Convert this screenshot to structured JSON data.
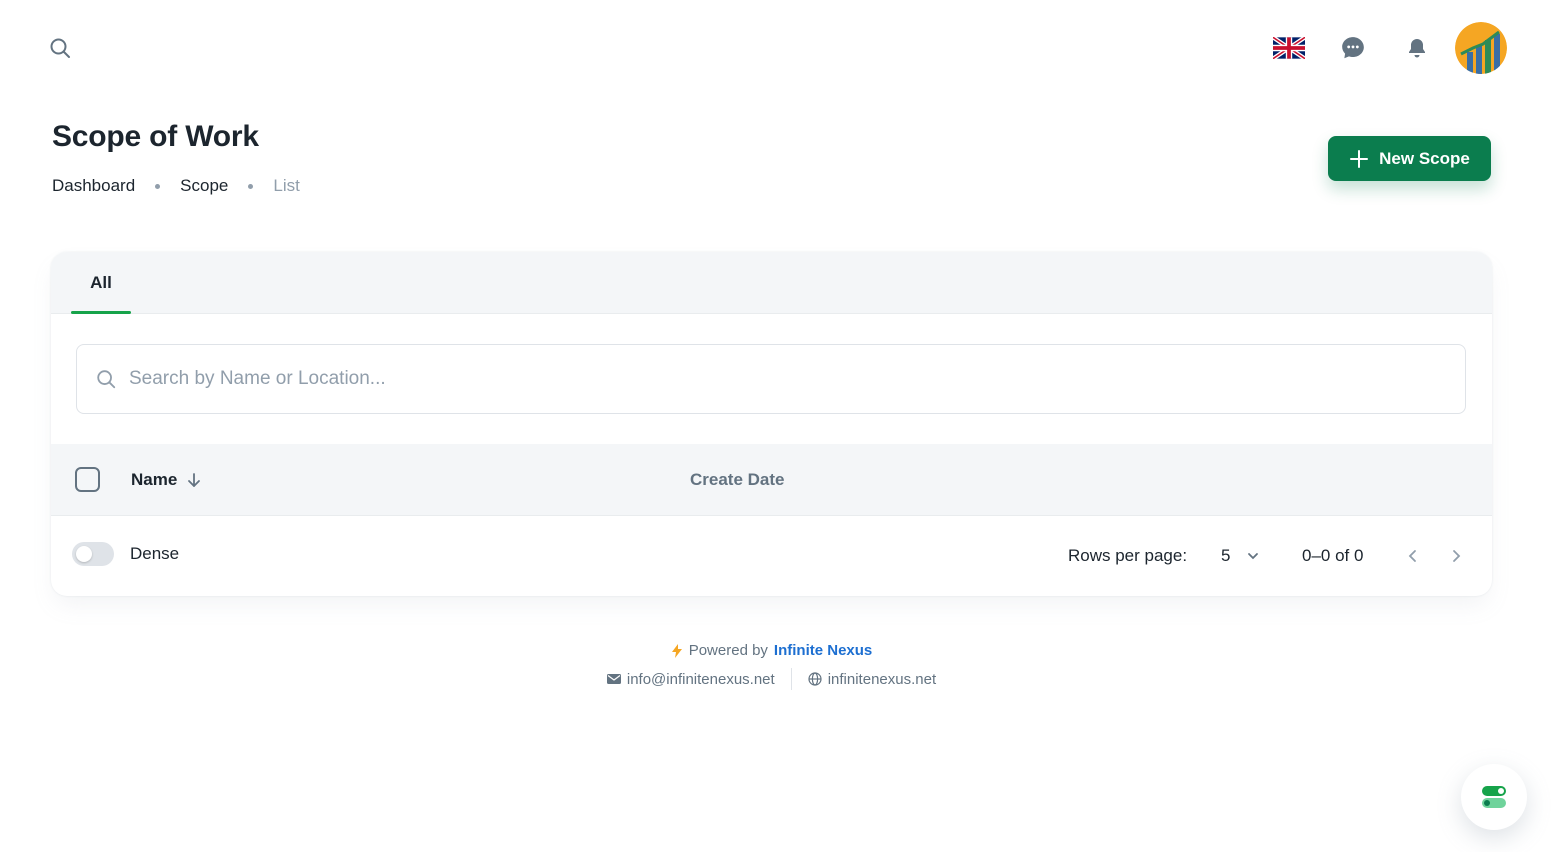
{
  "header": {
    "search_icon": "search-icon",
    "language_icon": "uk-flag-icon",
    "chat_icon": "chat-icon",
    "notification_icon": "bell-icon"
  },
  "page": {
    "title": "Scope of Work",
    "breadcrumbs": [
      "Dashboard",
      "Scope",
      "List"
    ],
    "new_button_label": "New Scope"
  },
  "tabs": [
    {
      "label": "All",
      "active": true
    }
  ],
  "search": {
    "placeholder": "Search by Name or Location..."
  },
  "table": {
    "columns": [
      "Name",
      "Create Date"
    ],
    "rows": []
  },
  "footer_controls": {
    "dense_label": "Dense",
    "dense_on": false,
    "rows_per_page_label": "Rows per page:",
    "rows_per_page_value": "5",
    "range_text": "0–0 of 0"
  },
  "site_footer": {
    "powered_by": "Powered by",
    "brand": "Infinite Nexus",
    "email": "info@infinitenexus.net",
    "website": "infinitenexus.net"
  },
  "colors": {
    "primary": "#0b7d4e",
    "tab_indicator": "#16a34a",
    "brand_link": "#1d6fd1"
  }
}
